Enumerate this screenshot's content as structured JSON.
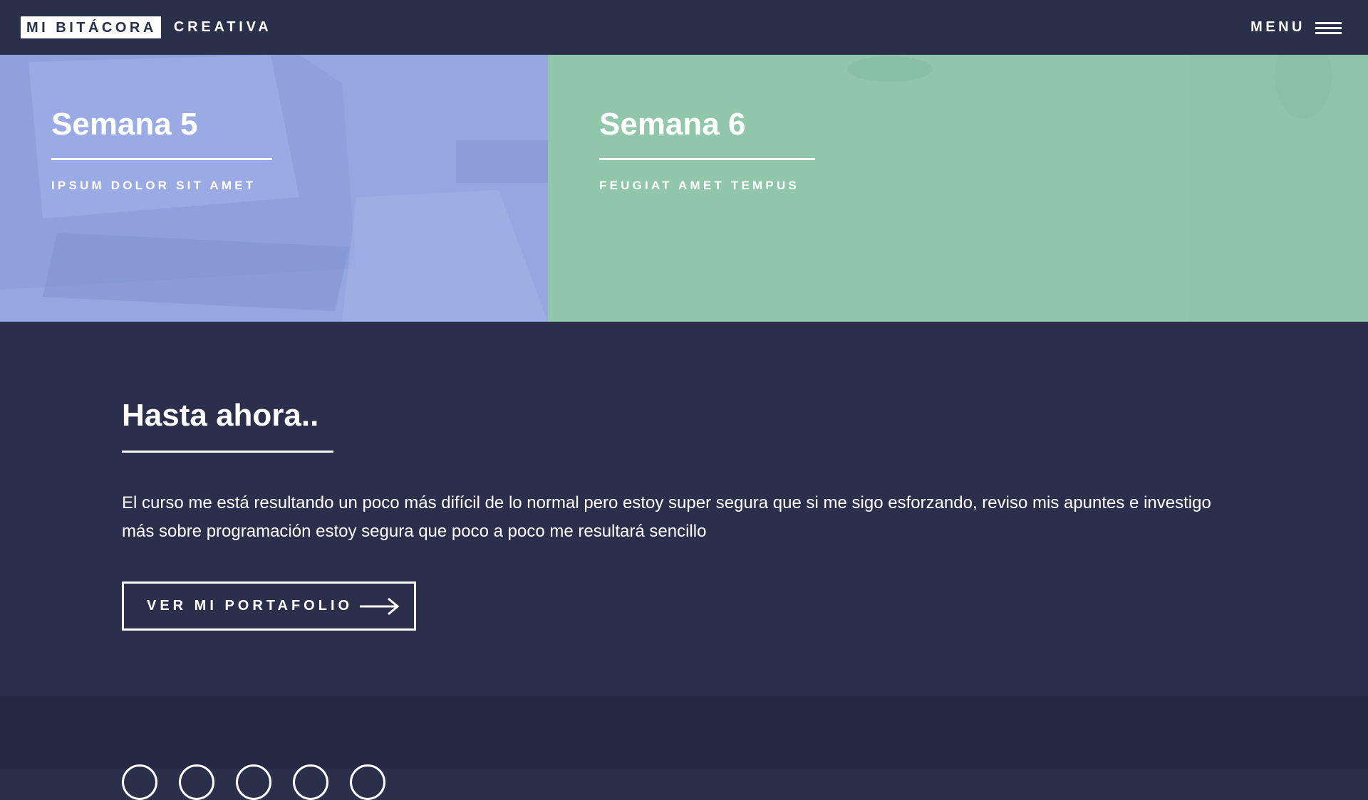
{
  "header": {
    "logo_boxed": "MI BITÁCORA",
    "logo_rest": "CREATIVA",
    "menu_label": "MENU"
  },
  "tiles": [
    {
      "title": "Semana 5",
      "subtitle": "IPSUM DOLOR SIT AMET",
      "color": "#95a6e1"
    },
    {
      "title": "Semana 6",
      "subtitle": "FEUGIAT AMET TEMPUS",
      "color": "#90c7aa"
    }
  ],
  "main": {
    "title": "Hasta ahora..",
    "text": "El curso me está resultando un poco más difícil de lo normal pero estoy super segura que si me sigo esforzando, reviso mis apuntes e investigo más sobre programación estoy segura que poco a poco me resultará sencillo",
    "button_label": "VER MI PORTAFOLIO"
  },
  "footer": {
    "social_icons": [
      "social-icon-1",
      "social-icon-2",
      "social-icon-3",
      "social-icon-4",
      "social-icon-5"
    ]
  },
  "colors": {
    "background": "#2a2f4a",
    "footer": "#242843",
    "text": "#ffffff"
  }
}
